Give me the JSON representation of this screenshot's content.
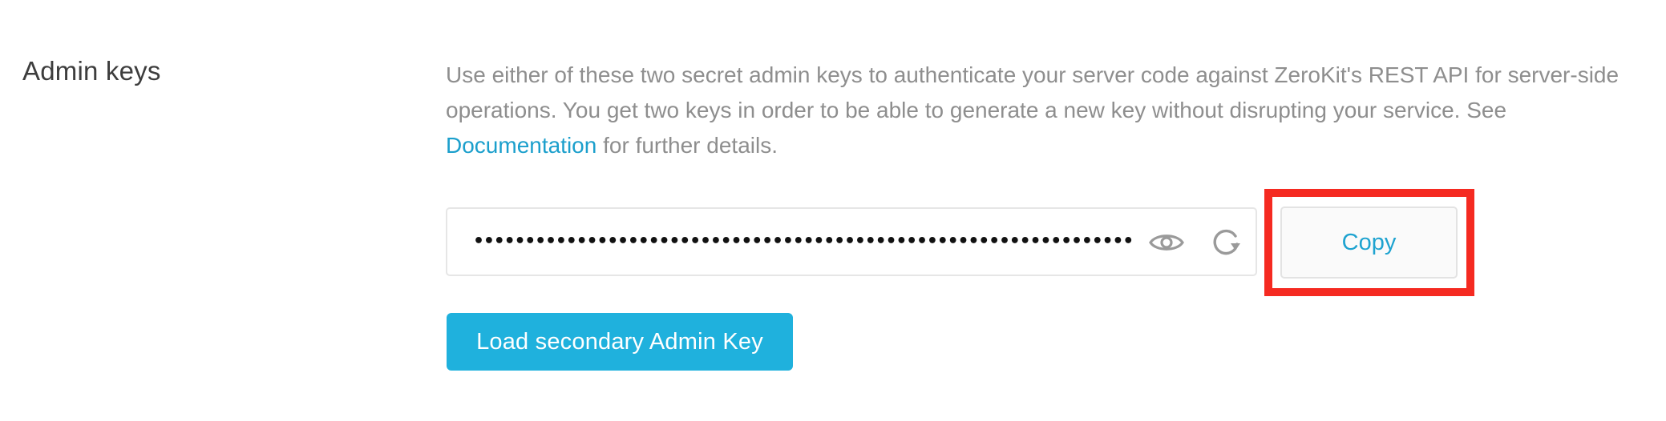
{
  "section": {
    "label": "Admin keys"
  },
  "description": {
    "before_link": "Use either of these two secret admin keys to authenticate your server code against ZeroKit's REST API for server-side operations. You get two keys in order to be able to generate a new key without disrupting your service. See ",
    "link_text": "Documentation",
    "after_link": " for further details."
  },
  "key_field": {
    "masked_value": "••••••••••••••••••••••••••••••••••••••••••••••••••••••••••••••••",
    "reveal_icon": "eye-icon",
    "regenerate_icon": "refresh-icon"
  },
  "copy_button": {
    "label": "Copy"
  },
  "load_button": {
    "label": "Load secondary Admin Key"
  },
  "colors": {
    "link": "#1b9fcc",
    "primary_button": "#1fb1dd",
    "highlight_border": "#f52a21",
    "body_text": "#8e8e8e"
  }
}
